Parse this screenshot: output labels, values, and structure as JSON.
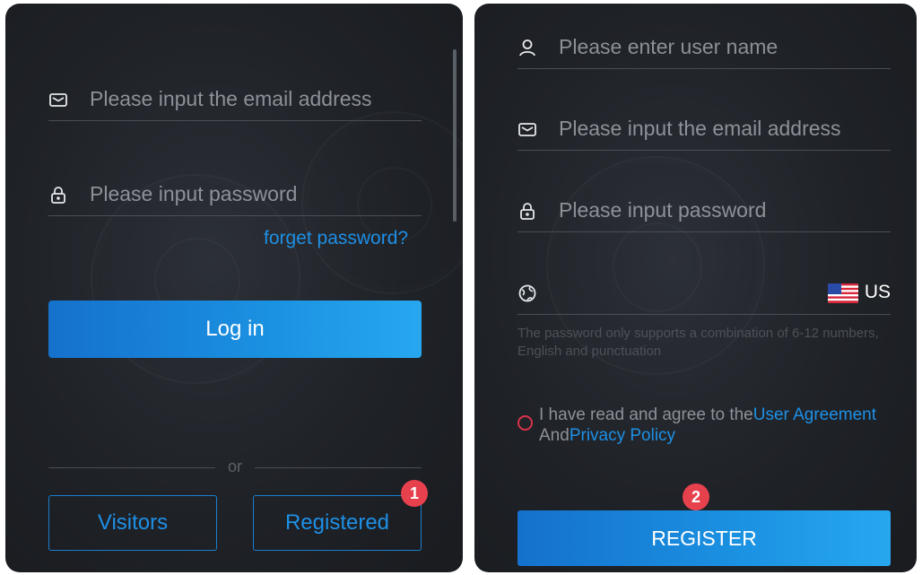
{
  "login": {
    "email_placeholder": "Please input the email address",
    "password_placeholder": "Please input password",
    "forget_link": "forget password?",
    "login_button": "Log in",
    "or_text": "or",
    "visitors_button": "Visitors",
    "registered_button": "Registered",
    "badge": "1"
  },
  "register": {
    "username_placeholder": "Please enter user name",
    "email_placeholder": "Please input the email address",
    "password_placeholder": "Please input password",
    "country_code": "US",
    "password_hint": "The password only supports a combination of 6-12 numbers, English and punctuation",
    "agreement_prefix": "I have read and agree to the",
    "user_agreement_link": "User Agreement",
    "agreement_and": "And",
    "privacy_policy_link": "Privacy Policy",
    "register_button": "REGISTER",
    "badge": "2"
  },
  "colors": {
    "accent_blue": "#1e90e6",
    "badge_red": "#e7414e",
    "panel_bg": "#1f2227"
  },
  "icons": {
    "email": "envelope-icon",
    "password": "lock-icon",
    "user": "user-icon",
    "region": "globe-icon",
    "flag": "us-flag-icon"
  }
}
